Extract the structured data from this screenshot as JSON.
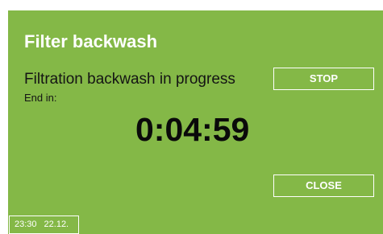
{
  "dialog": {
    "title": "Filter backwash",
    "status": "Filtration backwash in progress",
    "end_label": "End in:",
    "countdown": "0:04:59",
    "stop_label": "STOP",
    "close_label": "CLOSE"
  },
  "status_bar": {
    "time": "23:30",
    "date": "22.12."
  },
  "colors": {
    "background": "#84b847",
    "foreground": "#ffffff",
    "text": "#141414"
  }
}
